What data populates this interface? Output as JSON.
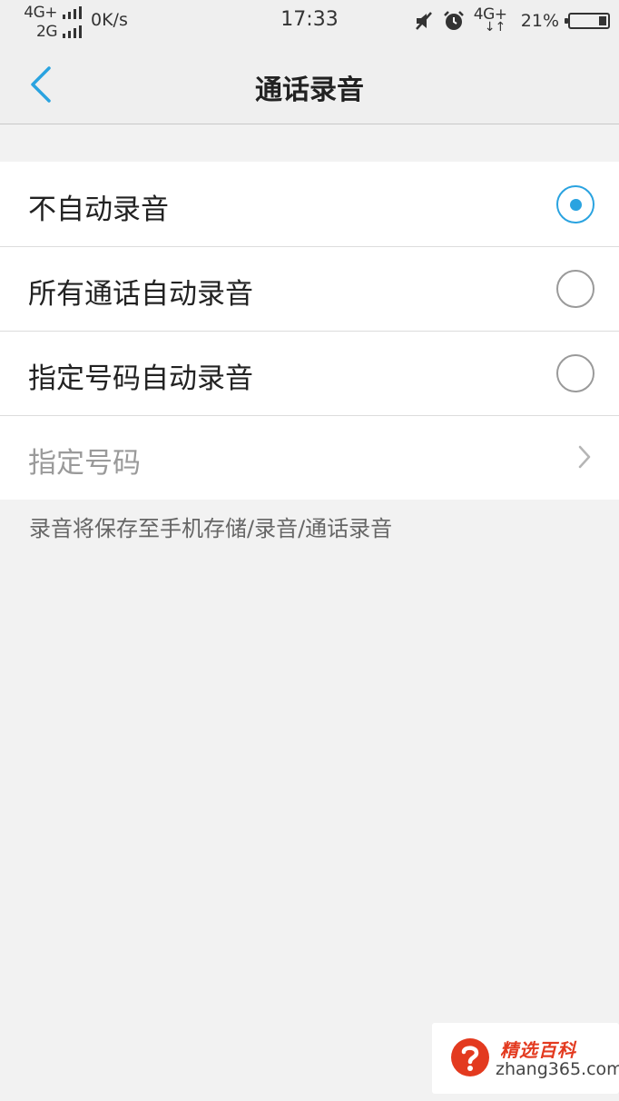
{
  "status_bar": {
    "network1": "4G+",
    "network2": "2G",
    "speed": "0K/s",
    "time": "17:33",
    "network3": "4G+",
    "network3_arrows": "↓↑",
    "battery_percent": "21%",
    "battery_level": 0.21,
    "icons": [
      "mute-icon",
      "alarm-icon"
    ]
  },
  "nav": {
    "back_icon": "chevron-left-icon",
    "title": "通话录音"
  },
  "options": [
    {
      "label": "不自动录音",
      "selected": true
    },
    {
      "label": "所有通话自动录音",
      "selected": false
    },
    {
      "label": "指定号码自动录音",
      "selected": false
    }
  ],
  "specified_numbers": {
    "label": "指定号码",
    "icon": "chevron-right-icon"
  },
  "footnote": "录音将保存至手机存储/录音/通话录音",
  "watermark": {
    "title": "精选百科",
    "url": "zhang365.com"
  },
  "colors": {
    "accent": "#2aa3e0",
    "background": "#f2f2f2",
    "watermark_red": "#e33a1f"
  }
}
